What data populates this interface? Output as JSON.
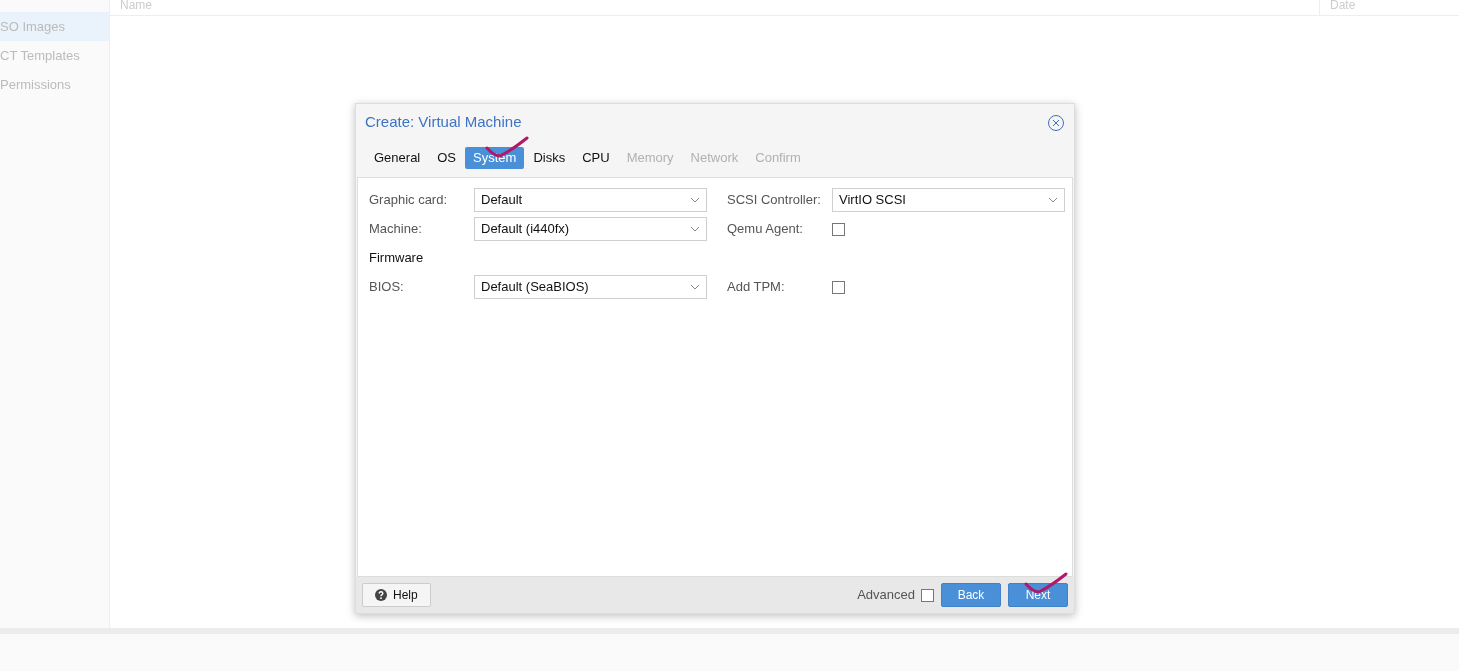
{
  "sidebar": {
    "items": [
      {
        "label": "SO Images",
        "selected": true
      },
      {
        "label": "CT Templates",
        "selected": false
      },
      {
        "label": "Permissions",
        "selected": false
      }
    ]
  },
  "table": {
    "columns": [
      "Name",
      "Date"
    ]
  },
  "dialog": {
    "title": "Create: Virtual Machine",
    "tabs": [
      {
        "label": "General",
        "selected": false,
        "disabled": false
      },
      {
        "label": "OS",
        "selected": false,
        "disabled": false
      },
      {
        "label": "System",
        "selected": true,
        "disabled": false
      },
      {
        "label": "Disks",
        "selected": false,
        "disabled": false
      },
      {
        "label": "CPU",
        "selected": false,
        "disabled": false
      },
      {
        "label": "Memory",
        "selected": false,
        "disabled": true
      },
      {
        "label": "Network",
        "selected": false,
        "disabled": true
      },
      {
        "label": "Confirm",
        "selected": false,
        "disabled": true
      }
    ],
    "rows": [
      {
        "kind": "fields",
        "fields": [
          {
            "label": "Graphic card:",
            "kind": "select",
            "value": "Default"
          },
          {
            "label": "SCSI Controller:",
            "kind": "select",
            "value": "VirtIO SCSI"
          }
        ]
      },
      {
        "kind": "fields",
        "fields": [
          {
            "label": "Machine:",
            "kind": "select",
            "value": "Default (i440fx)"
          },
          {
            "label": "Qemu Agent:",
            "kind": "checkbox",
            "checked": false
          }
        ]
      },
      {
        "kind": "heading",
        "label": "Firmware"
      },
      {
        "kind": "fields",
        "fields": [
          {
            "label": "BIOS:",
            "kind": "select",
            "value": "Default (SeaBIOS)"
          },
          {
            "label": "Add TPM:",
            "kind": "checkbox",
            "checked": false
          }
        ]
      }
    ],
    "footer": {
      "help": "Help",
      "advanced": {
        "label": "Advanced",
        "checked": false
      },
      "buttons": [
        "Back",
        "Next"
      ]
    }
  }
}
